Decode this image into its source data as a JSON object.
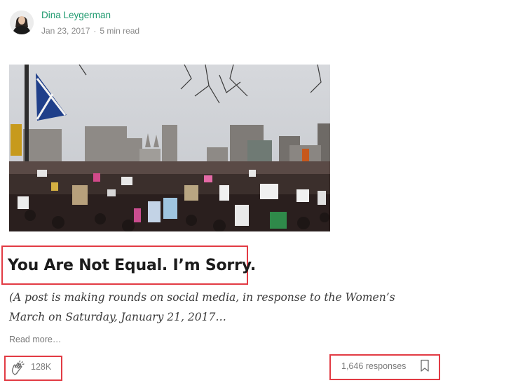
{
  "author": {
    "name": "Dina Leygerman",
    "date": "Jan 23, 2017",
    "separator": "·",
    "read_time": "5 min read",
    "avatar_icon": "author-avatar"
  },
  "post": {
    "title": "You Are Not Equal. I’m Sorry.",
    "subtitle": "(A post is making rounds on social media, in response to the Women’s March on Saturday, January 21, 2017…",
    "read_more": "Read more…",
    "hero_image": "photo-of-crowd-at-womens-march"
  },
  "footer": {
    "clap_icon": "clap-icon",
    "clap_count": "128K",
    "responses": "1,646 responses",
    "bookmark_icon": "bookmark-icon"
  },
  "colors": {
    "author_link": "#1f9a6f",
    "highlight_box": "#e23b44",
    "muted_text": "#7a7a7a"
  }
}
